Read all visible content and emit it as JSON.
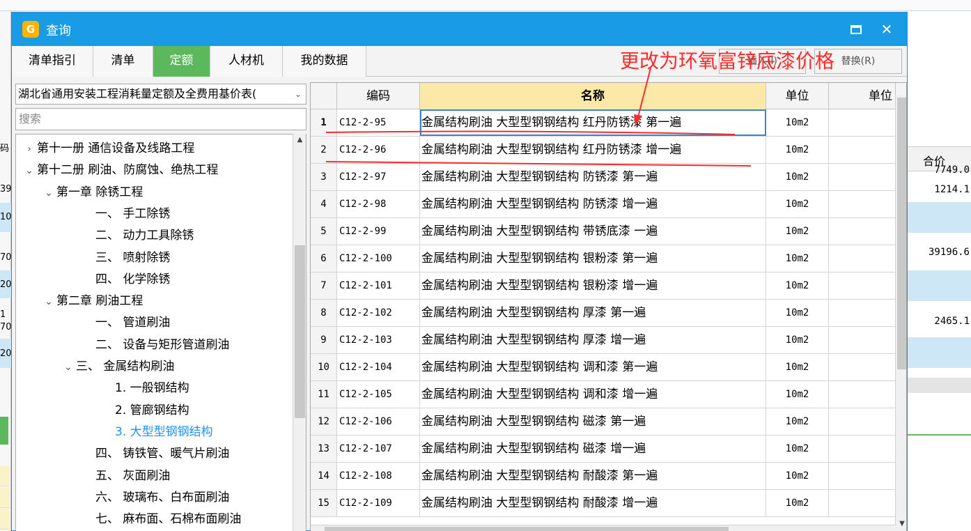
{
  "dialog": {
    "title": "查询",
    "maximize_label": "",
    "close_label": "✕"
  },
  "tabs": [
    {
      "label": "清单指引"
    },
    {
      "label": "清单"
    },
    {
      "label": "定额"
    },
    {
      "label": "人材机"
    },
    {
      "label": "我的数据"
    }
  ],
  "toolbar": {
    "insert_label": "插入(I)",
    "replace_label": "替换(R)"
  },
  "library": {
    "selected": "湖北省通用安装工程消耗量定额及全费用基价表(",
    "dropdown_arrow": "⌄"
  },
  "search": {
    "placeholder": "搜索"
  },
  "tree": [
    {
      "label": "第十一册 通信设备及线路工程",
      "chev": "›"
    },
    {
      "label": "第十二册 刷油、防腐蚀、绝热工程",
      "chev": "⌄"
    },
    {
      "label": "第一章 除锈工程",
      "chev": "⌄"
    },
    {
      "label": "一、 手工除锈",
      "chev": ""
    },
    {
      "label": "二、 动力工具除锈",
      "chev": ""
    },
    {
      "label": "三、 喷射除锈",
      "chev": ""
    },
    {
      "label": "四、 化学除锈",
      "chev": ""
    },
    {
      "label": "第二章 刷油工程",
      "chev": "⌄"
    },
    {
      "label": "一、 管道刷油",
      "chev": ""
    },
    {
      "label": "二、 设备与矩形管道刷油",
      "chev": ""
    },
    {
      "label": "三、 金属结构刷油",
      "chev": "⌄"
    },
    {
      "label": "1. 一般钢结构",
      "chev": ""
    },
    {
      "label": "2. 管廊钢结构",
      "chev": ""
    },
    {
      "label": "3. 大型型钢钢结构",
      "chev": ""
    },
    {
      "label": "四、 铸铁管、暖气片刷油",
      "chev": ""
    },
    {
      "label": "五、 灰面刷油",
      "chev": ""
    },
    {
      "label": "六、 玻璃布、白布面刷油",
      "chev": ""
    },
    {
      "label": "七、 麻布面、石棉布面刷油",
      "chev": ""
    }
  ],
  "grid": {
    "headers": {
      "code": "编码",
      "name": "名称",
      "unit": "单位",
      "price": "单位"
    },
    "rows": [
      {
        "idx": "1",
        "code": "C12-2-95",
        "name": "金属结构刷油 大型型钢钢结构 红丹防锈漆 第一遍",
        "unit": "10m2"
      },
      {
        "idx": "2",
        "code": "C12-2-96",
        "name": "金属结构刷油 大型型钢钢结构 红丹防锈漆 增一遍",
        "unit": "10m2"
      },
      {
        "idx": "3",
        "code": "C12-2-97",
        "name": "金属结构刷油 大型型钢钢结构 防锈漆 第一遍",
        "unit": "10m2"
      },
      {
        "idx": "4",
        "code": "C12-2-98",
        "name": "金属结构刷油 大型型钢钢结构 防锈漆 增一遍",
        "unit": "10m2"
      },
      {
        "idx": "5",
        "code": "C12-2-99",
        "name": "金属结构刷油 大型型钢钢结构 带锈底漆 一遍",
        "unit": "10m2"
      },
      {
        "idx": "6",
        "code": "C12-2-100",
        "name": "金属结构刷油 大型型钢钢结构 银粉漆 第一遍",
        "unit": "10m2"
      },
      {
        "idx": "7",
        "code": "C12-2-101",
        "name": "金属结构刷油 大型型钢钢结构 银粉漆 增一遍",
        "unit": "10m2"
      },
      {
        "idx": "8",
        "code": "C12-2-102",
        "name": "金属结构刷油 大型型钢钢结构 厚漆 第一遍",
        "unit": "10m2"
      },
      {
        "idx": "9",
        "code": "C12-2-103",
        "name": "金属结构刷油 大型型钢钢结构 厚漆 增一遍",
        "unit": "10m2"
      },
      {
        "idx": "10",
        "code": "C12-2-104",
        "name": "金属结构刷油 大型型钢钢结构 调和漆 第一遍",
        "unit": "10m2"
      },
      {
        "idx": "11",
        "code": "C12-2-105",
        "name": "金属结构刷油 大型型钢钢结构 调和漆 增一遍",
        "unit": "10m2"
      },
      {
        "idx": "12",
        "code": "C12-2-106",
        "name": "金属结构刷油 大型型钢钢结构 磁漆 第一遍",
        "unit": "10m2"
      },
      {
        "idx": "13",
        "code": "C12-2-107",
        "name": "金属结构刷油 大型型钢钢结构 磁漆 增一遍",
        "unit": "10m2"
      },
      {
        "idx": "14",
        "code": "C12-2-108",
        "name": "金属结构刷油 大型型钢钢结构 耐酸漆 第一遍",
        "unit": "10m2"
      },
      {
        "idx": "15",
        "code": "C12-2-109",
        "name": "金属结构刷油 大型型钢钢结构 耐酸漆 增一遍",
        "unit": "10m2"
      }
    ]
  },
  "annotation": {
    "text": "更改为环氧富锌底漆价格"
  },
  "background": {
    "right_header": "合价",
    "right_values": [
      "7749.0",
      "1214.1",
      "39196.6",
      "2465.1"
    ],
    "left_fragments": [
      "码",
      "39",
      "10",
      "70",
      "20",
      "1",
      "70",
      "20"
    ]
  },
  "colors": {
    "titlebar": "#1a9be6",
    "active_tab": "#5cb85c",
    "name_header": "#fde9a7",
    "selected_tree": "#1e90ff",
    "annotation": "#ff2a2a"
  }
}
